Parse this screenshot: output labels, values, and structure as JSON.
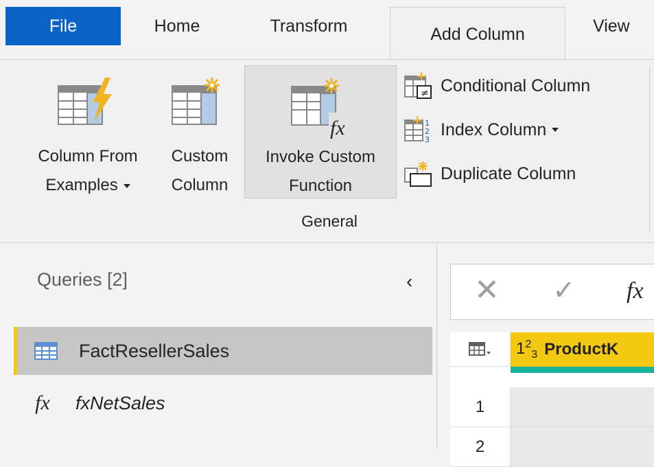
{
  "tabs": [
    {
      "label": "File"
    },
    {
      "label": "Home"
    },
    {
      "label": "Transform"
    },
    {
      "label": "Add Column"
    },
    {
      "label": "View"
    }
  ],
  "ribbon": {
    "column_from_examples": {
      "line1": "Column From",
      "line2": "Examples"
    },
    "custom_column": {
      "line1": "Custom",
      "line2": "Column"
    },
    "invoke_custom_function": {
      "line1": "Invoke Custom",
      "line2": "Function"
    },
    "conditional_column": "Conditional Column",
    "index_column": "Index Column",
    "duplicate_column": "Duplicate Column",
    "group_label": "General"
  },
  "queries": {
    "title": "Queries [2]",
    "collapse_glyph": "‹",
    "items": [
      {
        "label": "FactResellerSales",
        "selected": true
      },
      {
        "label": "fxNetSales",
        "selected": false
      }
    ]
  },
  "formula_bar": {
    "cancel": "✕",
    "commit": "✓",
    "fx": "fx"
  },
  "grid": {
    "column_header": {
      "type_main": "1",
      "type_sup": "2",
      "type_sub": "3",
      "name": "ProductK"
    },
    "rows": [
      "1",
      "2"
    ]
  },
  "colors": {
    "file_tab": "#0a64c8",
    "header_yellow": "#f2c811",
    "quality_bar": "#19b29c",
    "selected_query": "#c8c6c4"
  }
}
